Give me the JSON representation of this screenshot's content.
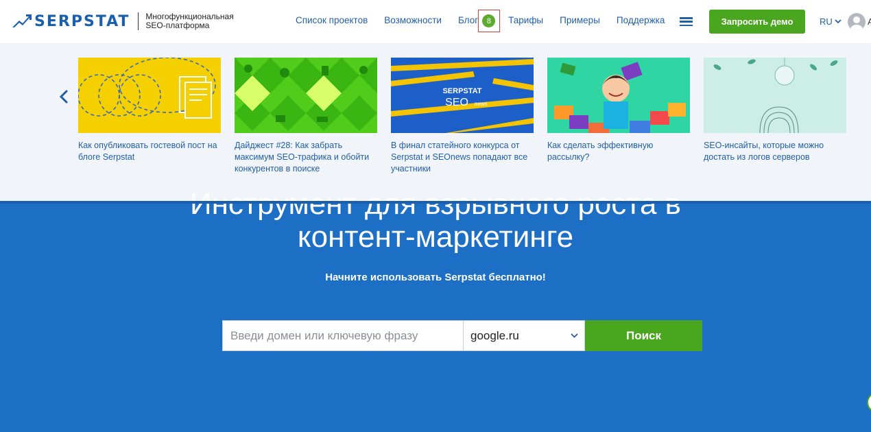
{
  "header": {
    "logo_text": "SERPSTAT",
    "tagline_line1": "Многофункциональная",
    "tagline_line2": "SEO-платформа",
    "nav": {
      "projects": "Список проектов",
      "features": "Возможности",
      "blog": "Блог",
      "blog_badge": "8",
      "pricing": "Тарифы",
      "examples": "Примеры",
      "support": "Поддержка"
    },
    "demo_button": "Запросить демо",
    "language": "RU",
    "user_initial": "А"
  },
  "blog_panel": {
    "cards": [
      {
        "title": "Как опубликовать гостевой пост на блоге Serpstat",
        "thumb_color": "#f5d000"
      },
      {
        "title": "Дайджест #28: Как забрать максимум SEO-трафика и обойти конкурентов в поиске",
        "thumb_color": "#52cc1a"
      },
      {
        "title": "В финал статейного конкурса от Serpstat и SEOnews попадают все участники",
        "thumb_color": "#1d5fc9",
        "thumb_text_1": "SERPSTAT",
        "thumb_text_2": "SEO",
        "thumb_text_3": "news"
      },
      {
        "title": "Как сделать эффективную рассылку?",
        "thumb_color": "#2fd6a3"
      },
      {
        "title": "SEO-инсайты, которые можно достать из логов серверов",
        "thumb_color": "#cdeee6"
      }
    ]
  },
  "hero": {
    "title_line1": "Инструмент для взрывного роста в",
    "title_line2": "контент-маркетинге",
    "subtitle": "Начните использовать Serpstat бесплатно!"
  },
  "search": {
    "placeholder": "Введи домен или ключевую фразу",
    "engine": "google.ru",
    "button": "Поиск"
  },
  "colors": {
    "brand_blue": "#1b5eac",
    "hero_blue": "#1c6fc4",
    "accent_green": "#4aa51f",
    "badge_outline": "#e53935"
  }
}
